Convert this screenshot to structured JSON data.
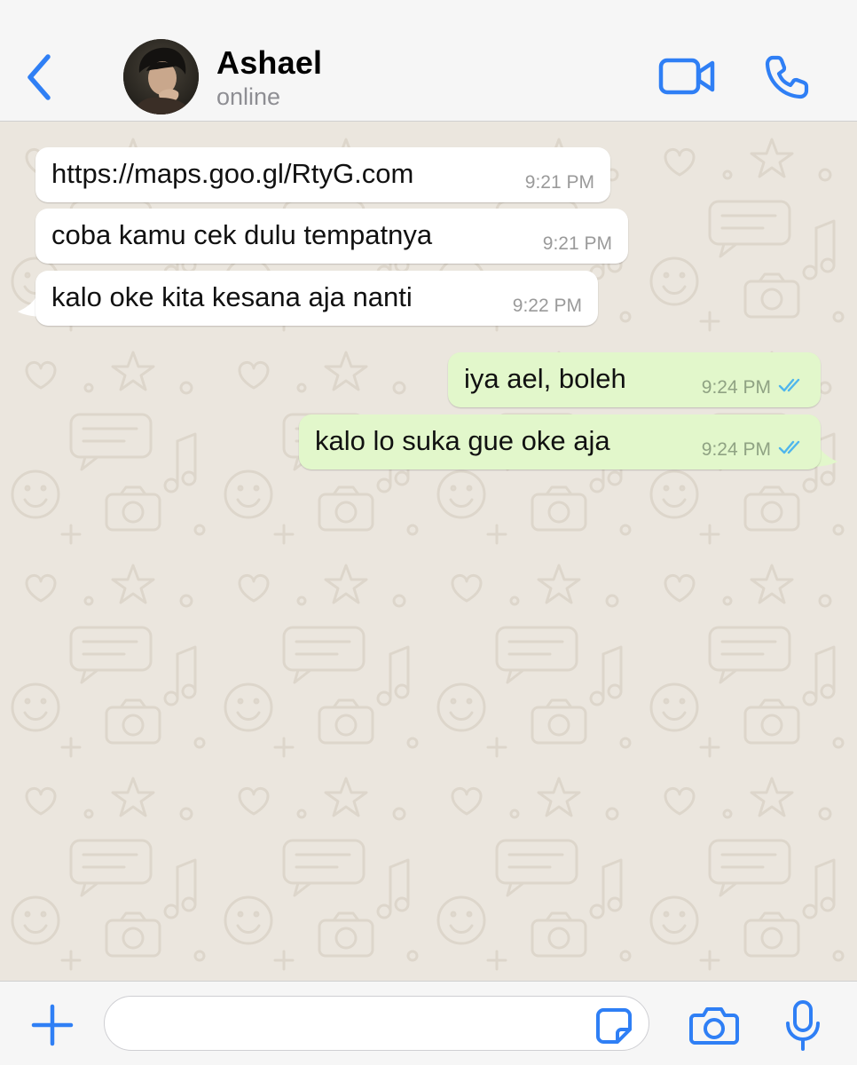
{
  "theme": {
    "accent": "#2f7ff5",
    "incoming_bubble": "#ffffff",
    "outgoing_bubble": "#e2f7cb",
    "read_ticks": "#4fb6ec",
    "chat_background": "#ebe6de"
  },
  "header": {
    "back_icon": "chevron-left-icon",
    "contact_name": "Ashael",
    "status": "online",
    "video_icon": "video-camera-icon",
    "call_icon": "phone-icon"
  },
  "messages": [
    {
      "direction": "incoming",
      "text": "https://maps.goo.gl/RtyG.com",
      "time": "9:21 PM"
    },
    {
      "direction": "incoming",
      "text": "coba kamu cek dulu tempatnya",
      "time": "9:21 PM"
    },
    {
      "direction": "incoming",
      "text": "kalo oke kita kesana aja nanti",
      "time": "9:22 PM"
    },
    {
      "direction": "outgoing",
      "text": "iya ael, boleh",
      "time": "9:24 PM",
      "status": "read"
    },
    {
      "direction": "outgoing",
      "text": "kalo lo suka gue oke aja",
      "time": "9:24 PM",
      "status": "read"
    }
  ],
  "composer": {
    "plus_icon": "plus-icon",
    "input_value": "",
    "sticker_icon": "sticker-icon",
    "camera_icon": "camera-icon",
    "mic_icon": "microphone-icon"
  }
}
